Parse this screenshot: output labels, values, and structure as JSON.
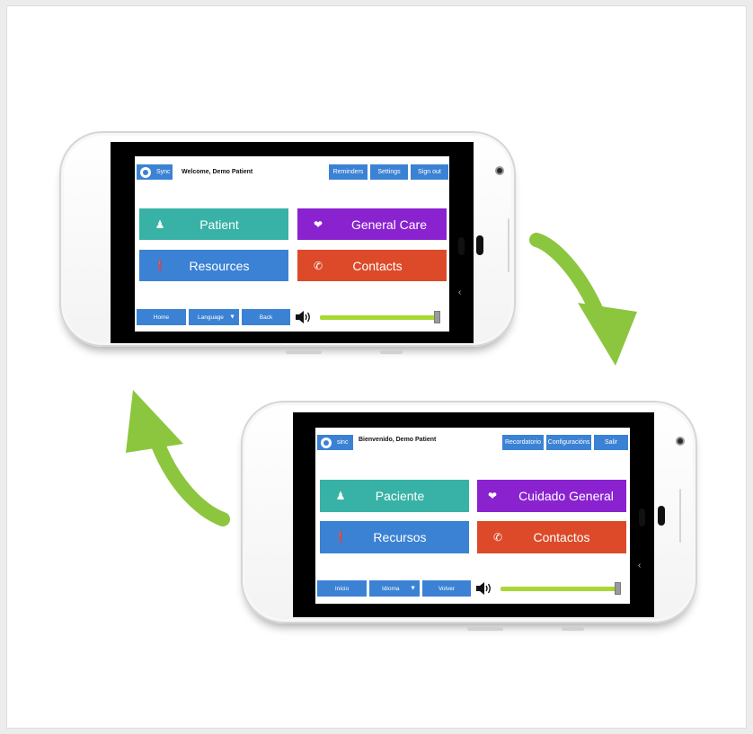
{
  "english_app": {
    "sync_label": "Sync",
    "welcome": "Welcome, Demo Patient",
    "header_buttons": [
      "Reminders",
      "Settings",
      "Sign out"
    ],
    "tiles": {
      "patient": "Patient",
      "general_care": "General Care",
      "resources": "Resources",
      "contacts": "Contacts"
    },
    "footer": {
      "home": "Home",
      "language": "Language",
      "back": "Back"
    },
    "volume_level": 0.97
  },
  "spanish_app": {
    "sync_label": "sinc",
    "welcome": "Bienvenido, Demo Patient",
    "header_buttons": [
      "Recordatorio",
      "Configuracións",
      "Salir"
    ],
    "tiles": {
      "patient": "Paciente",
      "general_care": "Cuidado General",
      "resources": "Recursos",
      "contacts": "Contactos"
    },
    "footer": {
      "home": "Inicio",
      "language": "Idioma",
      "back": "Volver"
    },
    "volume_level": 0.97
  },
  "icons": {
    "patient": "user-icon",
    "general_care": "heart-icon",
    "resources": "alert-icon",
    "contacts": "phone-icon",
    "sync": "sync-icon",
    "volume": "speaker-icon",
    "language": "caret-down-icon"
  },
  "colors": {
    "teal": "#38b2a6",
    "purple": "#8a22d0",
    "blue": "#3b82d4",
    "orange": "#dc4a2a",
    "slider": "#a8d832",
    "arrow": "#8cc63f"
  }
}
